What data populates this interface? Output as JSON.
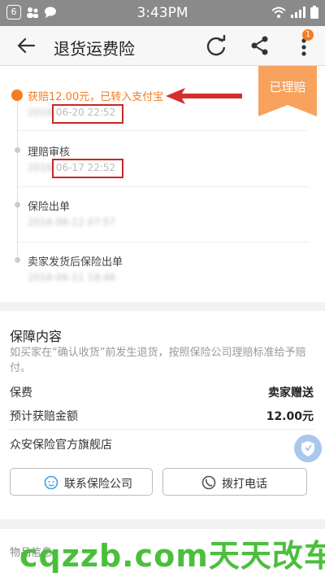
{
  "status_bar": {
    "notif_count": "6",
    "time": "3:43PM"
  },
  "app_bar": {
    "title": "退货运费险",
    "more_badge": "1"
  },
  "claim_status": {
    "ribbon": "已理赔"
  },
  "timeline": [
    {
      "title": "获赔12.00元，已转入支付宝",
      "year": "2016-",
      "time": "06-20 22:52",
      "active": true
    },
    {
      "title": "理赔审核",
      "year": "2016-",
      "time": "06-17 22:52",
      "active": false
    },
    {
      "title": "保险出单",
      "year": "",
      "time": "2016-06-12 07:57",
      "active": false
    },
    {
      "title": "卖家发货后保险出单",
      "year": "",
      "time": "2016-06-11 18:46",
      "active": false
    }
  ],
  "coverage": {
    "title": "保障内容",
    "description": "如买家在“确认收货”前发生退货，按照保险公司理赔标准给予赔付。",
    "premium_label": "保费",
    "premium_value": "卖家赠送",
    "payout_label": "预计获赔金额",
    "payout_value": "12.00元",
    "shop": "众安保险官方旗舰店"
  },
  "actions": {
    "contact": "联系保险公司",
    "call": "拨打电话"
  },
  "goods": {
    "label": "物品信息"
  },
  "watermark": "cqzzb.com天天改车",
  "colors": {
    "accent": "#f57c20",
    "highlight": "#c62828"
  }
}
